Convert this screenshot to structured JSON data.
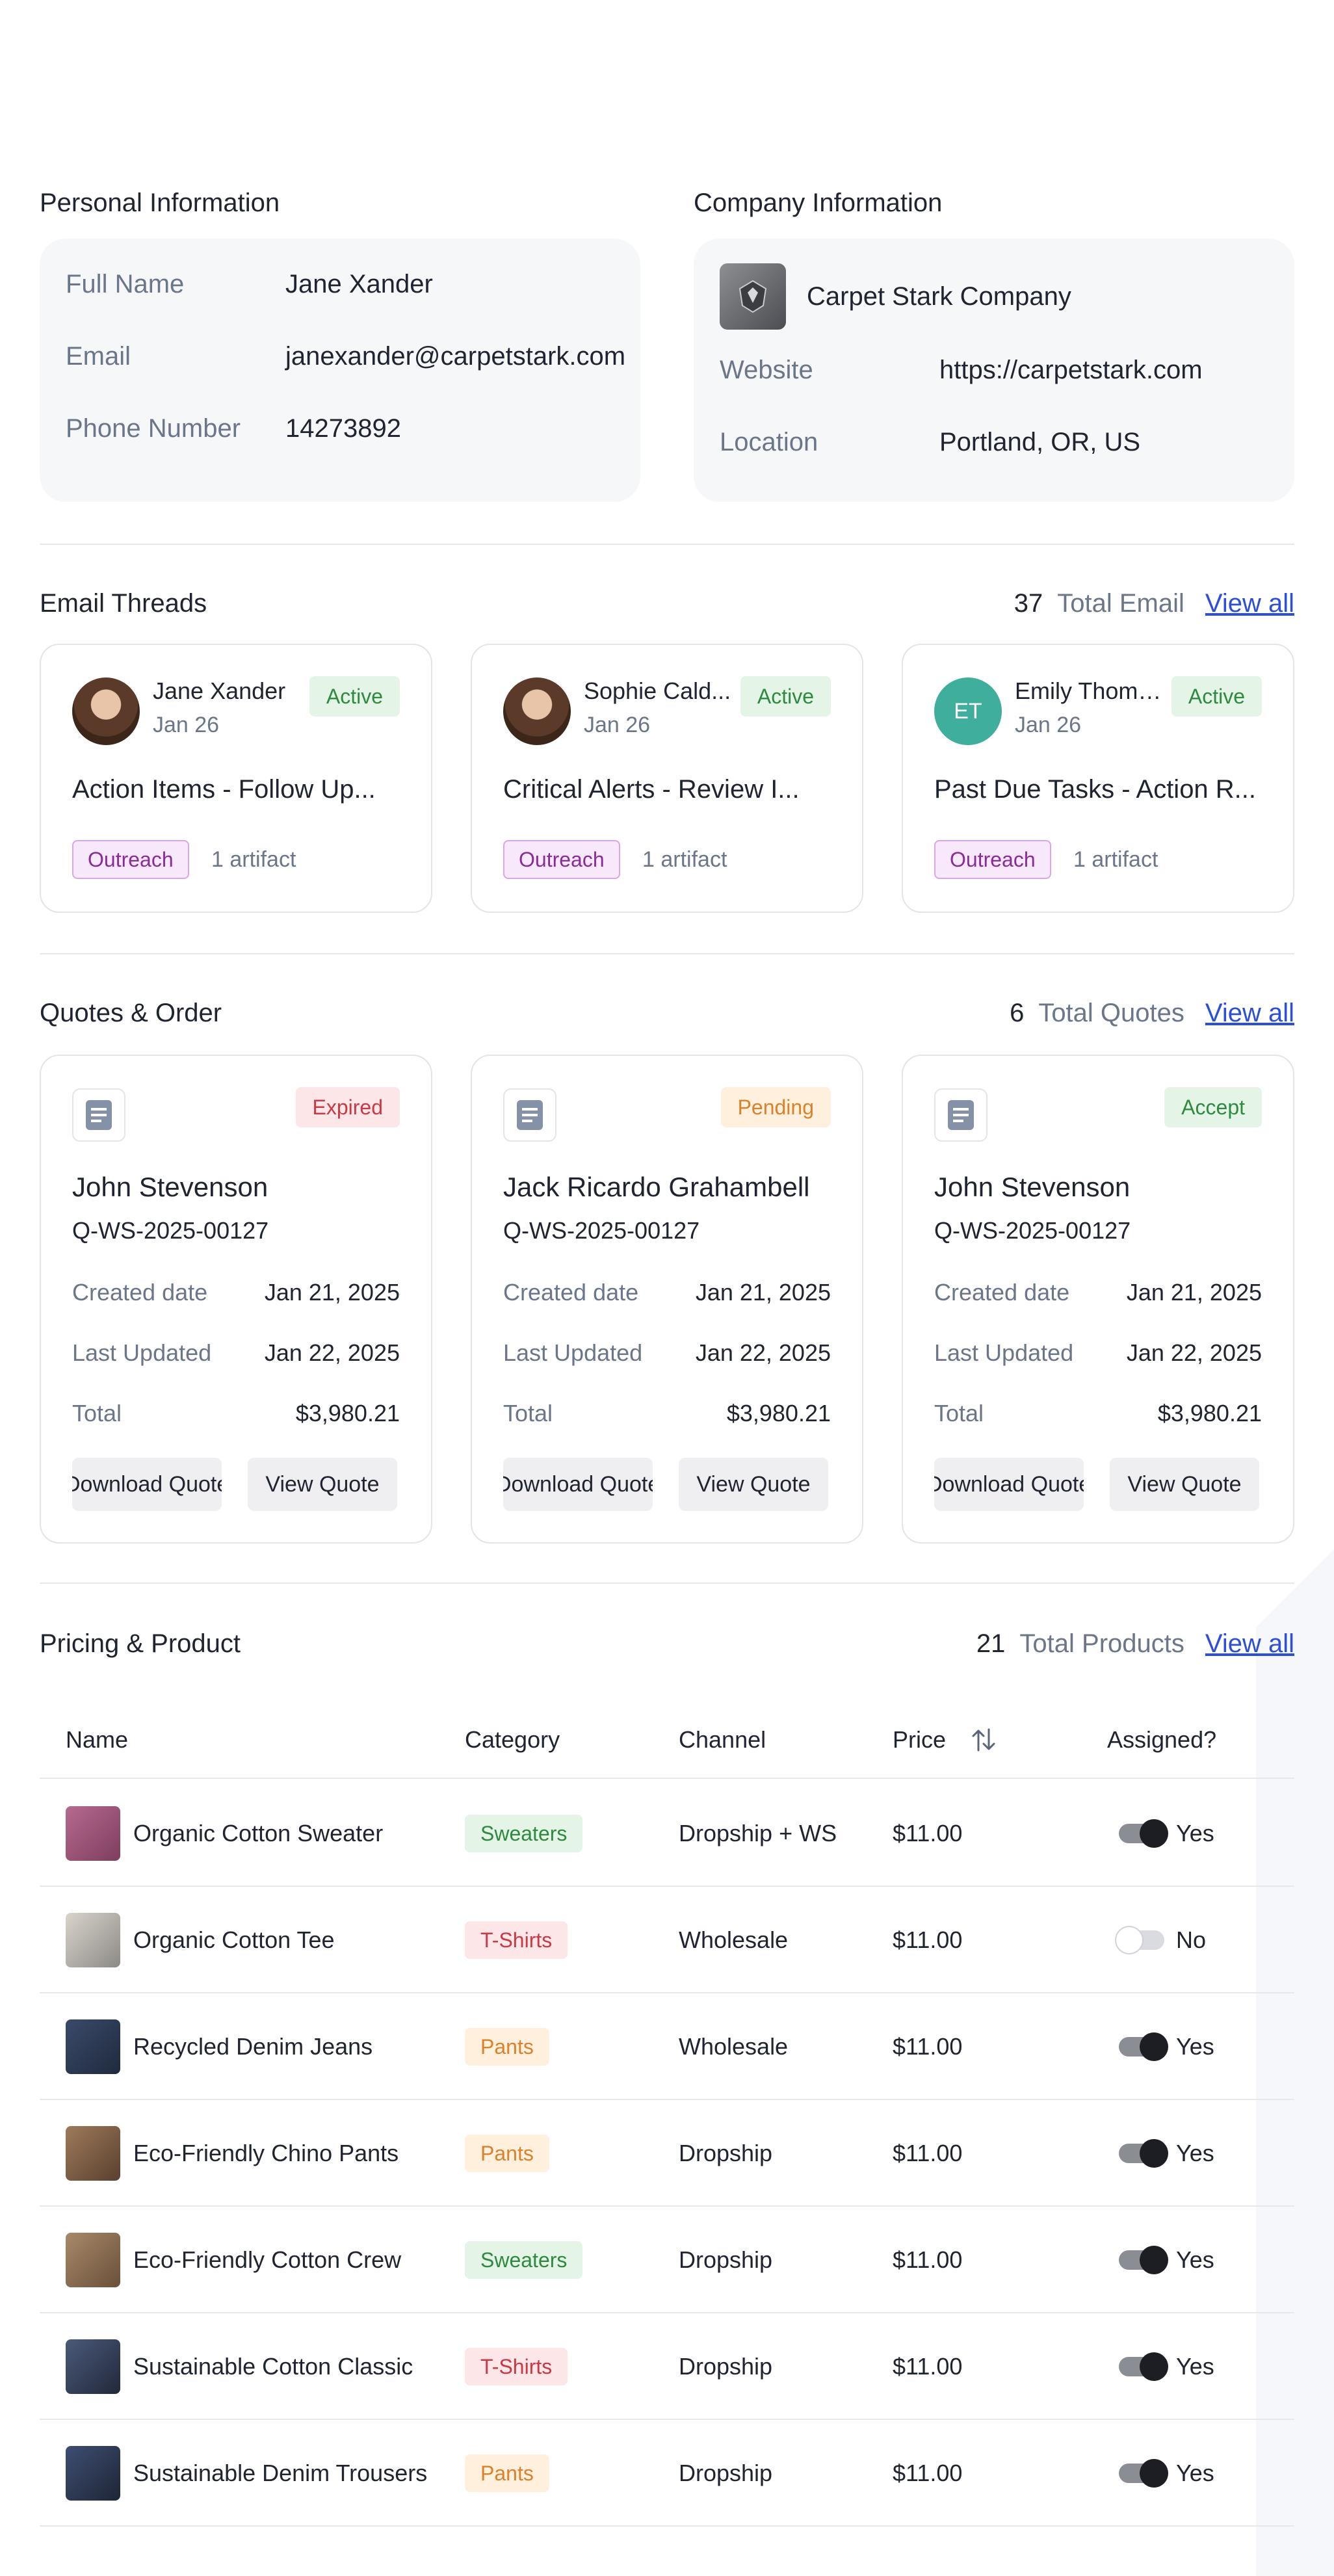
{
  "personal": {
    "title": "Personal Information",
    "fields": [
      {
        "label": "Full Name",
        "value": "Jane Xander"
      },
      {
        "label": "Email",
        "value": "janexander@carpetstark.com"
      },
      {
        "label": "Phone Number",
        "value": "14273892"
      }
    ]
  },
  "company": {
    "title": "Company Information",
    "name": "Carpet Stark Company",
    "fields": [
      {
        "label": "Website",
        "value": "https://carpetstark.com"
      },
      {
        "label": "Location",
        "value": "Portland, OR, US"
      }
    ]
  },
  "emails": {
    "title": "Email Threads",
    "count": "37",
    "count_label": "Total Email",
    "view_all": "View all",
    "threads": [
      {
        "name": "Jane Xander",
        "date": "Jan 26",
        "status": "Active",
        "subject": "Action Items - Follow Up...",
        "tag": "Outreach",
        "artifacts": "1 artifact"
      },
      {
        "name": "Sophie Cald...",
        "date": "Jan 26",
        "status": "Active",
        "subject": "Critical Alerts - Review I...",
        "tag": "Outreach",
        "artifacts": "1 artifact"
      },
      {
        "name": "Emily Thomp...",
        "initials": "ET",
        "date": "Jan 26",
        "status": "Active",
        "subject": "Past Due Tasks - Action R...",
        "tag": "Outreach",
        "artifacts": "1 artifact"
      }
    ]
  },
  "quotes": {
    "title": "Quotes & Order",
    "count": "6",
    "count_label": "Total Quotes",
    "view_all": "View all",
    "created_label": "Created date",
    "updated_label": "Last Updated",
    "total_label": "Total",
    "download_label": "Download Quote",
    "view_label": "View Quote",
    "items": [
      {
        "status": "Expired",
        "name": "John Stevenson",
        "id": "Q-WS-2025-00127",
        "created": "Jan 21, 2025",
        "updated": "Jan 22, 2025",
        "total": "$3,980.21"
      },
      {
        "status": "Pending",
        "name": "Jack Ricardo Grahambell",
        "id": "Q-WS-2025-00127",
        "created": "Jan 21, 2025",
        "updated": "Jan 22, 2025",
        "total": "$3,980.21"
      },
      {
        "status": "Accept",
        "name": "John Stevenson",
        "id": "Q-WS-2025-00127",
        "created": "Jan 21, 2025",
        "updated": "Jan 22, 2025",
        "total": "$3,980.21"
      }
    ]
  },
  "products": {
    "title": "Pricing & Product",
    "count": "21",
    "count_label": "Total Products",
    "view_all": "View all",
    "columns": {
      "name": "Name",
      "category": "Category",
      "channel": "Channel",
      "price": "Price",
      "assigned": "Assigned?"
    },
    "rows": [
      {
        "name": "Organic Cotton Sweater",
        "category": "Sweaters",
        "channel": "Dropship + WS",
        "price": "$11.00",
        "assigned": "Yes"
      },
      {
        "name": "Organic Cotton Tee",
        "category": "T-Shirts",
        "channel": "Wholesale",
        "price": "$11.00",
        "assigned": "No"
      },
      {
        "name": "Recycled Denim Jeans",
        "category": "Pants",
        "channel": "Wholesale",
        "price": "$11.00",
        "assigned": "Yes"
      },
      {
        "name": "Eco-Friendly Chino Pants",
        "category": "Pants",
        "channel": "Dropship",
        "price": "$11.00",
        "assigned": "Yes"
      },
      {
        "name": "Eco-Friendly Cotton Crew",
        "category": "Sweaters",
        "channel": "Dropship",
        "price": "$11.00",
        "assigned": "Yes"
      },
      {
        "name": "Sustainable Cotton Classic",
        "category": "T-Shirts",
        "channel": "Dropship",
        "price": "$11.00",
        "assigned": "Yes"
      },
      {
        "name": "Sustainable Denim Trousers",
        "category": "Pants",
        "channel": "Dropship",
        "price": "$11.00",
        "assigned": "Yes"
      }
    ]
  },
  "colors": {
    "link": "#2c4fd6",
    "active": "#2e8a3e",
    "expired": "#c83a44",
    "pending": "#d9822b",
    "outreach": "#8b2a9b",
    "avatar_et": "#3fae9d"
  }
}
